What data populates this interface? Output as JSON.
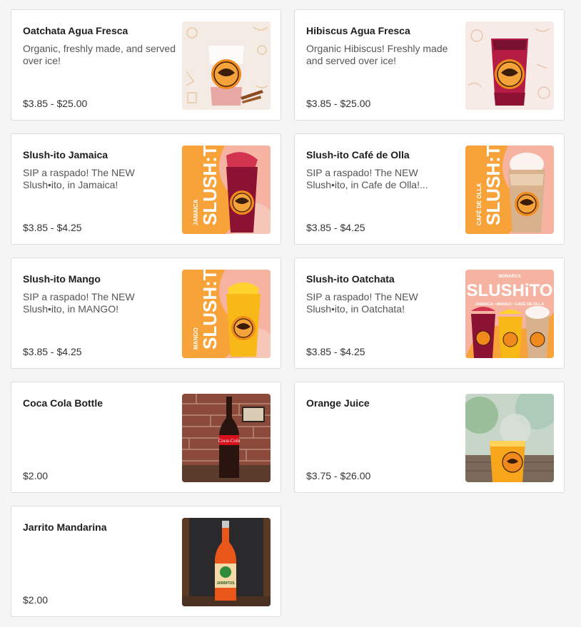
{
  "menu": {
    "items": [
      {
        "title": "Oatchata Agua Fresca",
        "description": "Organic, freshly made, and served over ice!",
        "price": "$3.85 - $25.00",
        "image": "oatchata-cup-photo"
      },
      {
        "title": "Hibiscus Agua Fresca",
        "description": "Organic Hibiscus! Freshly made and served over ice!",
        "price": "$3.85 - $25.00",
        "image": "hibiscus-cup-photo"
      },
      {
        "title": "Slush-ito Jamaica",
        "description": "SIP a raspado! The NEW Slush•ito, in Jamaica!",
        "price": "$3.85 - $4.25",
        "image": "slushito-jamaica-photo",
        "banner": "SLUSH:TO",
        "side": "JAMAICA"
      },
      {
        "title": "Slush-ito Café de Olla",
        "description": "SIP a raspado! The NEW Slush•ito, in Cafe de Olla!...",
        "price": "$3.85 - $4.25",
        "image": "slushito-cafe-photo",
        "banner": "SLUSH:TO",
        "side": "CAFÉ DE OLLA"
      },
      {
        "title": "Slush-ito Mango",
        "description": "SIP a raspado! The NEW Slush•ito, in MANGO!",
        "price": "$3.85 - $4.25",
        "image": "slushito-mango-photo",
        "banner": "SLUSH:TO",
        "side": "MANGO"
      },
      {
        "title": "Slush-ito Oatchata",
        "description": "SIP a raspado! The NEW Slush•ito, in Oatchata!",
        "price": "$3.85 - $4.25",
        "image": "slushito-trio-photo",
        "banner": "SLUSHiTO",
        "brand": "MONARCA",
        "flavors": "JAMAICA • MANGO • CAFÉ DE OLLA"
      },
      {
        "title": "Coca Cola Bottle",
        "description": "",
        "price": "$2.00",
        "image": "coca-cola-bottle-photo",
        "bottle_label": "Coca-Cola"
      },
      {
        "title": "Orange Juice",
        "description": "",
        "price": "$3.75 - $26.00",
        "image": "orange-juice-photo"
      },
      {
        "title": "Jarrito Mandarina",
        "description": "",
        "price": "$2.00",
        "image": "jarrito-bottle-photo",
        "bottle_label": "JARRITOS"
      }
    ]
  },
  "colors": {
    "background": "#f6f5f6",
    "card_border": "#dcdcdc",
    "title": "#1d1d1d",
    "description": "#555555",
    "monarca_orange": "#f08a1c"
  }
}
